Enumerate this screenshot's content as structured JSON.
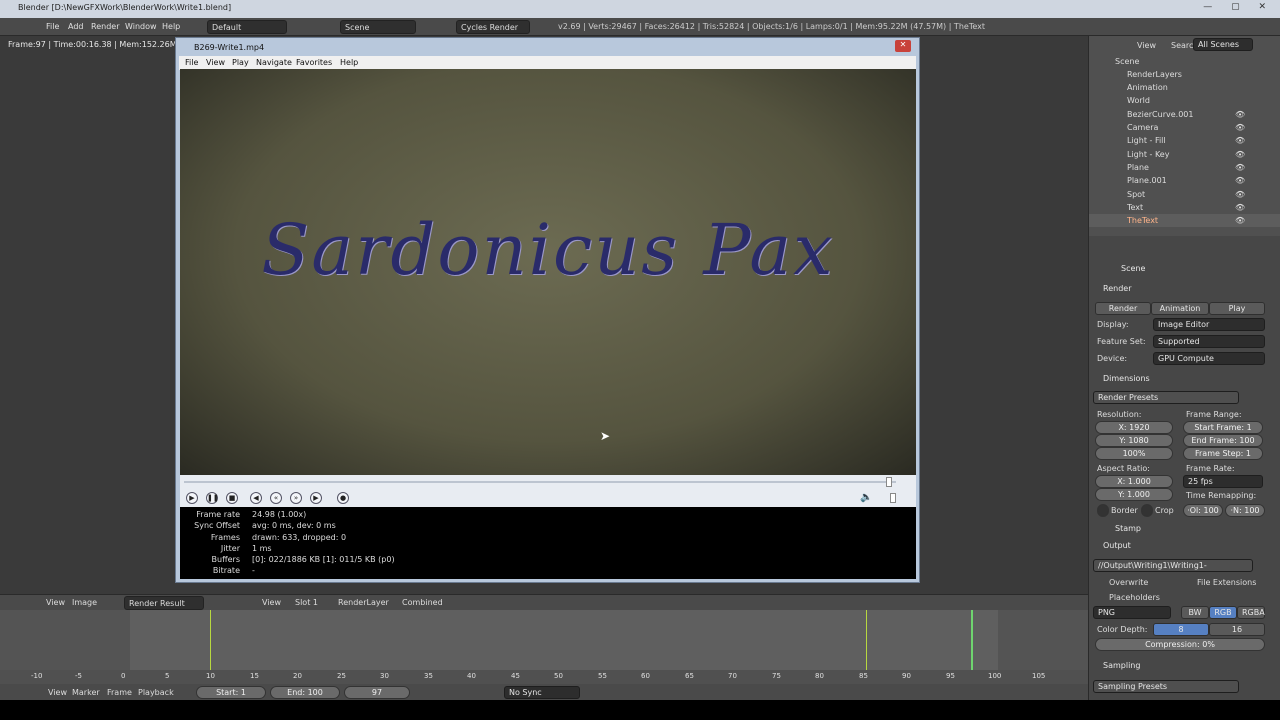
{
  "window": {
    "title": "Blender [D:\\NewGFXWork\\BlenderWork\\Write1.blend]"
  },
  "topbar": {
    "menus": [
      "File",
      "Add",
      "Render",
      "Window",
      "Help"
    ],
    "layout": "Default",
    "scene": "Scene",
    "engine": "Cycles Render",
    "stats": "v2.69 | Verts:29467 | Faces:26412 | Tris:52824 | Objects:1/6 | Lamps:0/1 | Mem:95.22M (47.57M) | TheText"
  },
  "viewport": {
    "info": "Frame:97 | Time:00:16.38 | Mem:152.26M, Peak"
  },
  "player": {
    "title": "B269-Write1.mp4",
    "menus": [
      "File",
      "View",
      "Play",
      "Navigate",
      "Favorites",
      "Help"
    ],
    "video_text": "Sardonicus Pax",
    "stats": [
      {
        "k": "Frame rate",
        "v": "24.98 (1.00x)"
      },
      {
        "k": "Sync Offset",
        "v": "avg: 0 ms, dev: 0 ms"
      },
      {
        "k": "Frames",
        "v": "drawn: 633, dropped: 0"
      },
      {
        "k": "Jitter",
        "v": "1 ms"
      },
      {
        "k": "Buffers",
        "v": "[0]: 022/1886 KB [1]: 011/5 KB (p0)"
      },
      {
        "k": "Bitrate",
        "v": "-"
      }
    ]
  },
  "outliner": {
    "header": {
      "view": "View",
      "search": "Search",
      "filter": "All Scenes"
    },
    "items": [
      "Scene",
      "RenderLayers",
      "Animation",
      "World",
      "BezierCurve.001",
      "Camera",
      "Light - Fill",
      "Light - Key",
      "Plane",
      "Plane.001",
      "Spot",
      "Text",
      "TheText"
    ]
  },
  "props": {
    "context": "Scene",
    "render": "Render",
    "btn_render": "Render",
    "btn_anim": "Animation",
    "btn_play": "Play",
    "display_label": "Display:",
    "display": "Image Editor",
    "feature_label": "Feature Set:",
    "feature": "Supported",
    "device_label": "Device:",
    "device": "GPU Compute",
    "dimensions": "Dimensions",
    "presets": "Render Presets",
    "resolution": "Resolution:",
    "resx": "X: 1920",
    "resy": "Y: 1080",
    "respct": "100%",
    "frame_range": "Frame Range:",
    "start": "Start Frame: 1",
    "end": "End Frame: 100",
    "step": "Frame Step: 1",
    "aspect": "Aspect Ratio:",
    "ax": "X: 1.000",
    "ay": "Y: 1.000",
    "frame_rate": "Frame Rate:",
    "fps": "25 fps",
    "remap": "Time Remapping:",
    "old": "·Ol: 100",
    "new": "·N: 100",
    "border": "Border",
    "crop": "Crop",
    "stamp": "Stamp",
    "output": "Output",
    "path": "//Output\\Writing1\\Writing1-",
    "overwrite": "Overwrite",
    "file_ext": "File Extensions",
    "placeholders": "Placeholders",
    "format": "PNG",
    "bw": "BW",
    "rgb": "RGB",
    "rgba": "RGBA",
    "color_depth": "Color Depth:",
    "d8": "8",
    "d16": "16",
    "compression": "Compression: 0%",
    "sampling": "Sampling",
    "sampling_presets": "Sampling Presets"
  },
  "image_editor": {
    "view": "View",
    "image": "Image",
    "name": "Render Result",
    "view2": "View",
    "slot": "Slot 1",
    "layer": "RenderLayer",
    "pass": "Combined"
  },
  "timeline": {
    "ticks": [
      "-10",
      "-5",
      "0",
      "5",
      "10",
      "15",
      "20",
      "25",
      "30",
      "35",
      "40",
      "45",
      "50",
      "55",
      "60",
      "65",
      "70",
      "75",
      "80",
      "85",
      "90",
      "95",
      "100",
      "105"
    ]
  },
  "bottom": {
    "view": "View",
    "marker": "Marker",
    "frame": "Frame",
    "playback": "Playback",
    "start": "Start: 1",
    "end": "End: 100",
    "current": "97",
    "sync": "No Sync"
  }
}
